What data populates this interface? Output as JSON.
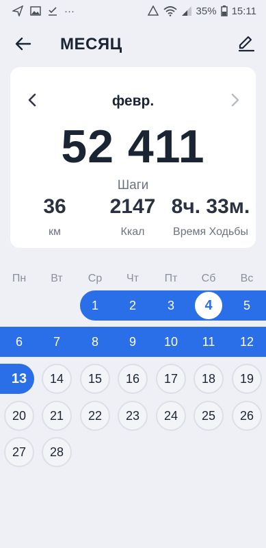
{
  "status_bar": {
    "battery": "35%",
    "time": "15:11",
    "ellipsis": "···"
  },
  "header": {
    "title": "МЕСЯЦ",
    "back_icon": "arrow-left-icon",
    "edit_icon": "pencil-icon"
  },
  "summary": {
    "month": "февр.",
    "steps_value": "52 411",
    "steps_label": "Шаги",
    "stats": [
      {
        "value": "36",
        "label": "км"
      },
      {
        "value": "2147",
        "label": "Ккал"
      },
      {
        "value": "8ч. 33м.",
        "label": "Время Ходьбы"
      }
    ]
  },
  "calendar": {
    "weekdays": [
      "Пн",
      "Вт",
      "Ср",
      "Чт",
      "Пт",
      "Сб",
      "Вс"
    ],
    "days": [
      {
        "day": "1",
        "state": "active"
      },
      {
        "day": "2",
        "state": "active"
      },
      {
        "day": "3",
        "state": "active"
      },
      {
        "day": "4",
        "state": "selected"
      },
      {
        "day": "5",
        "state": "active"
      },
      {
        "day": "6",
        "state": "active"
      },
      {
        "day": "7",
        "state": "active"
      },
      {
        "day": "8",
        "state": "active"
      },
      {
        "day": "9",
        "state": "active"
      },
      {
        "day": "10",
        "state": "active"
      },
      {
        "day": "11",
        "state": "active"
      },
      {
        "day": "12",
        "state": "active"
      },
      {
        "day": "13",
        "state": "today"
      },
      {
        "day": "14",
        "state": "future"
      },
      {
        "day": "15",
        "state": "future"
      },
      {
        "day": "16",
        "state": "future"
      },
      {
        "day": "17",
        "state": "future"
      },
      {
        "day": "18",
        "state": "future"
      },
      {
        "day": "19",
        "state": "future"
      },
      {
        "day": "20",
        "state": "future"
      },
      {
        "day": "21",
        "state": "future"
      },
      {
        "day": "22",
        "state": "future"
      },
      {
        "day": "23",
        "state": "future"
      },
      {
        "day": "24",
        "state": "future"
      },
      {
        "day": "25",
        "state": "future"
      },
      {
        "day": "26",
        "state": "future"
      },
      {
        "day": "27",
        "state": "future"
      },
      {
        "day": "28",
        "state": "future"
      }
    ]
  },
  "colors": {
    "accent": "#2a6ee8",
    "background": "#eef0f6",
    "card": "#ffffff"
  }
}
